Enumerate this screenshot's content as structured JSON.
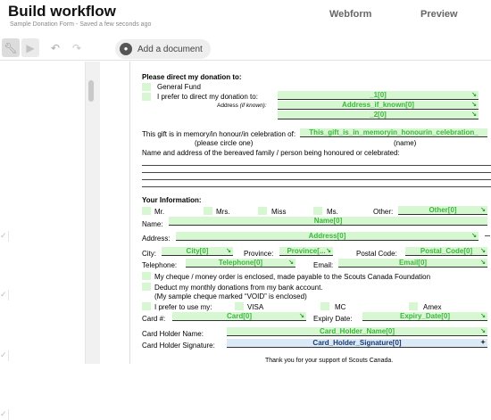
{
  "header": {
    "title": "Build workflow",
    "subtitle": "Sample Donation Form - Saved a few seconds ago",
    "tabs": [
      "Webform",
      "Preview"
    ]
  },
  "toolbar": {
    "add_document_label": "Add a document",
    "icons": [
      "wrench-icon",
      "play-icon",
      "undo-icon",
      "redo-icon",
      "lock-icon"
    ]
  },
  "form": {
    "direct_heading": "Please direct my donation to:",
    "general_fund": "General Fund",
    "prefer_direct": "I prefer to direct my donation to:",
    "address_if_known": "Address",
    "if_known": "(if known):",
    "field_1": "_1[0]",
    "field_address": "Address_if_known[0]",
    "field_2": "_2[0]",
    "memory_text": "This gift is in memory/in honour/in celebration of:",
    "memory_field": "This_gift_is_in_memoryin_honourin_celebration_",
    "circle_one": "(please circle one)",
    "name_caption": "(name)",
    "bereaved_text": "Name and address of the bereaved family / person being honoured or celebrated:",
    "your_info": "Your Information:",
    "mr": "Mr.",
    "mrs": "Mrs.",
    "miss": "Miss",
    "ms": "Ms.",
    "other": "Other:",
    "field_other": "Other[0]",
    "name_label": "Name:",
    "field_name": "Name[0]",
    "address_label": "Address:",
    "field_address2": "Address[0]",
    "city_label": "City:",
    "field_city": "City[0]",
    "province_label": "Province:",
    "field_province": "Province[...",
    "postal_label": "Postal Code:",
    "field_postal": "Postal_Code[0]",
    "telephone_label": "Telephone:",
    "field_telephone": "Telephone[0]",
    "email_label": "Email:",
    "field_email": "Email[0]",
    "cheque_text": "My cheque / money order is enclosed, made payable to the Scouts Canada Foundation",
    "deduct_text": "Deduct my monthly donations from my bank account.",
    "void_text": "(My sample cheque marked “VOID” is enclosed)",
    "prefer_use": "I prefer to use my:",
    "visa": "VISA",
    "mc": "MC",
    "amex": "Amex",
    "card_label": "Card #:",
    "field_card": "Card[0]",
    "expiry_label": "Expiry Date:",
    "field_expiry": "Expiry_Date[0]",
    "holder_label": "Card Holder Name:",
    "field_holder": "Card_Holder_Name[0]",
    "sig_label": "Card Holder Signature:",
    "field_sig": "Card_Holder_Signature[0]",
    "thanks": "Thank you for your support of Scouts Canada."
  },
  "colors": {
    "field_fill": "#d7f6d2",
    "field_text": "#3cb83c",
    "signature_fill": "#dce9f7"
  }
}
